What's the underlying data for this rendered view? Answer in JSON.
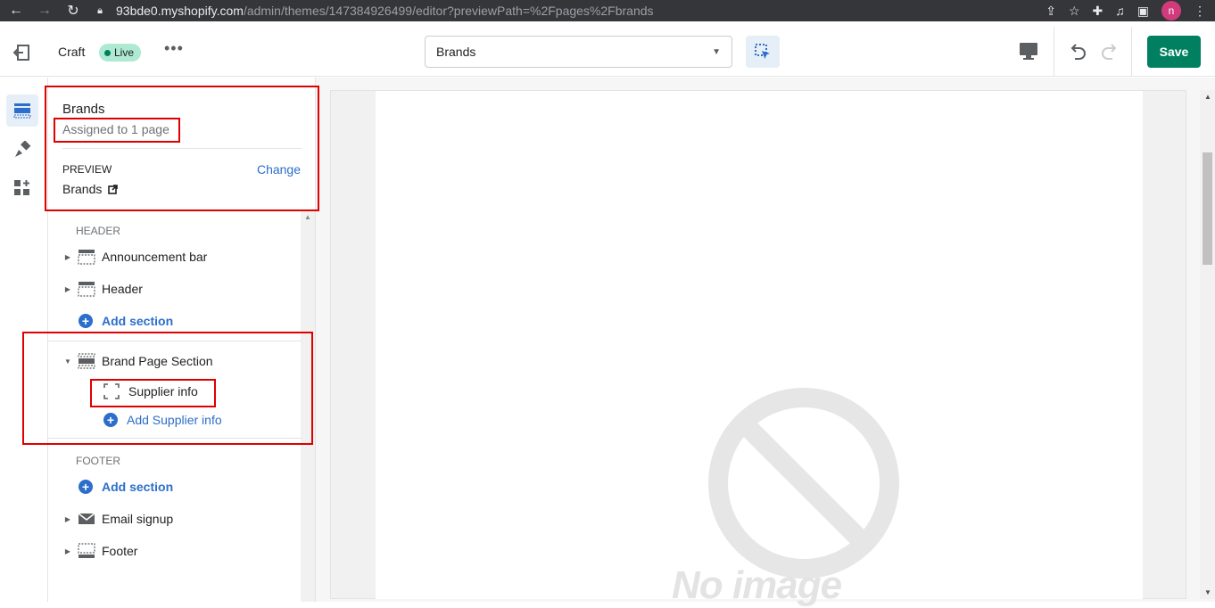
{
  "browser": {
    "url_host": "93bde0.myshopify.com",
    "url_path": "/admin/themes/147384926499/editor?previewPath=%2Fpages%2Fbrands",
    "profile_initial": "n"
  },
  "topbar": {
    "theme_name": "Craft",
    "status_badge": "Live",
    "more_label": "•••",
    "page_select_value": "Brands",
    "save_label": "Save"
  },
  "sidebar": {
    "title": "Brands",
    "subtitle": "Assigned to 1 page",
    "preview_label": "PREVIEW",
    "change_label": "Change",
    "preview_value": "Brands",
    "header_group": {
      "label": "HEADER",
      "sections": [
        {
          "label": "Announcement bar",
          "icon": "section-icon"
        },
        {
          "label": "Header",
          "icon": "section-icon"
        }
      ],
      "add_label": "Add section"
    },
    "template_group": {
      "section_label": "Brand Page Section",
      "block_label": "Supplier info",
      "add_block_label": "Add Supplier info"
    },
    "footer_group": {
      "label": "FOOTER",
      "add_label": "Add section",
      "sections": [
        {
          "label": "Email signup",
          "icon": "mail-icon"
        },
        {
          "label": "Footer",
          "icon": "section-icon"
        }
      ]
    }
  },
  "canvas": {
    "placeholder_text": "No image"
  },
  "colors": {
    "accent": "#2c6ecb",
    "primary": "#008060",
    "highlight": "#e00000",
    "badge_bg": "#aee9d1"
  }
}
